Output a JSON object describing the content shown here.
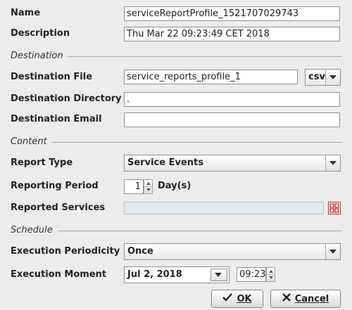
{
  "name": {
    "label": "Name",
    "value": "serviceReportProfile_1521707029743"
  },
  "description": {
    "label": "Description",
    "value": "Thu Mar 22 09:23:49 CET 2018"
  },
  "sections": {
    "destination": "Destination",
    "content": "Content",
    "schedule": "Schedule"
  },
  "destination_file": {
    "label": "Destination File",
    "value": "service_reports_profile_1",
    "format": "csv"
  },
  "destination_directory": {
    "label": "Destination Directory",
    "value": "."
  },
  "destination_email": {
    "label": "Destination Email",
    "value": ""
  },
  "report_type": {
    "label": "Report Type",
    "value": "Service Events"
  },
  "reporting_period": {
    "label": "Reporting Period",
    "value": "1",
    "unit": "Day(s)"
  },
  "reported_services": {
    "label": "Reported Services",
    "value": ""
  },
  "execution_periodicity": {
    "label": "Execution Periodicity",
    "value": "Once"
  },
  "execution_moment": {
    "label": "Execution Moment",
    "date": "Jul 2, 2018",
    "time": "09:23"
  },
  "buttons": {
    "ok": "OK",
    "cancel": "Cancel"
  },
  "icons": {
    "ok": "check-icon",
    "cancel": "x-icon",
    "select_services": "grid-select-icon"
  },
  "colors": {
    "accent_red": "#cc2222",
    "section_line": "#9aa7bc"
  }
}
